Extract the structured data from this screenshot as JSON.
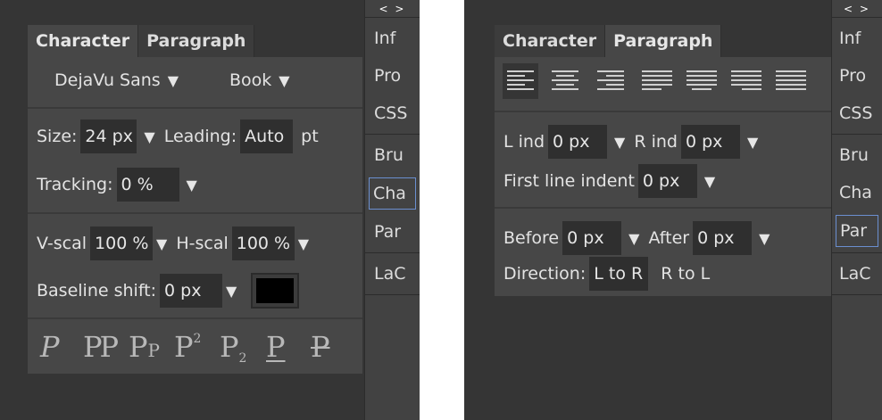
{
  "left": {
    "tabs": [
      "Character",
      "Paragraph"
    ],
    "font": {
      "family": "DejaVu Sans",
      "style": "Book"
    },
    "size": {
      "label": "Size:",
      "value": "24 px"
    },
    "leading": {
      "label": "Leading:",
      "value": "Auto",
      "unit": "pt"
    },
    "tracking": {
      "label": "Tracking:",
      "value": "0 %"
    },
    "vscale": {
      "label": "V-scal",
      "value": "100 %"
    },
    "hscale": {
      "label": "H-scal",
      "value": "100 %"
    },
    "baseline": {
      "label": "Baseline shift:",
      "value": "0 px"
    },
    "text_color": "#000000",
    "style_buttons": [
      {
        "name": "italic",
        "text": "P"
      },
      {
        "name": "small-caps",
        "text": "PP"
      },
      {
        "name": "all-caps",
        "text": "PP"
      },
      {
        "name": "superscript",
        "text": "P",
        "sup": "2"
      },
      {
        "name": "subscript",
        "text": "P",
        "sub": "2"
      },
      {
        "name": "underline",
        "text": "P"
      },
      {
        "name": "strikethrough",
        "text": "P"
      }
    ],
    "sidebar": [
      "Inf",
      "Pro",
      "CSS",
      "Bru",
      "Cha",
      "Par",
      "LaC"
    ],
    "sidebar_active": "Cha",
    "arrows": "< >"
  },
  "right": {
    "tabs": [
      "Character",
      "Paragraph"
    ],
    "lind": {
      "label": "L ind",
      "value": "0 px"
    },
    "rind": {
      "label": "R ind",
      "value": "0 px"
    },
    "first_line": {
      "label": "First line indent",
      "value": "0 px"
    },
    "before": {
      "label": "Before",
      "value": "0 px"
    },
    "after": {
      "label": "After",
      "value": "0 px"
    },
    "direction": {
      "label": "Direction:",
      "ltr": "L to R",
      "rtl": "R to L"
    },
    "align_buttons": [
      "left",
      "center",
      "right",
      "justify",
      "justify-left",
      "justify-center",
      "justify-right"
    ],
    "sidebar": [
      "Inf",
      "Pro",
      "CSS",
      "Bru",
      "Cha",
      "Par",
      "LaC"
    ],
    "sidebar_active": "Par",
    "arrows": "< >"
  },
  "icons": {
    "dropdown": "▼"
  }
}
